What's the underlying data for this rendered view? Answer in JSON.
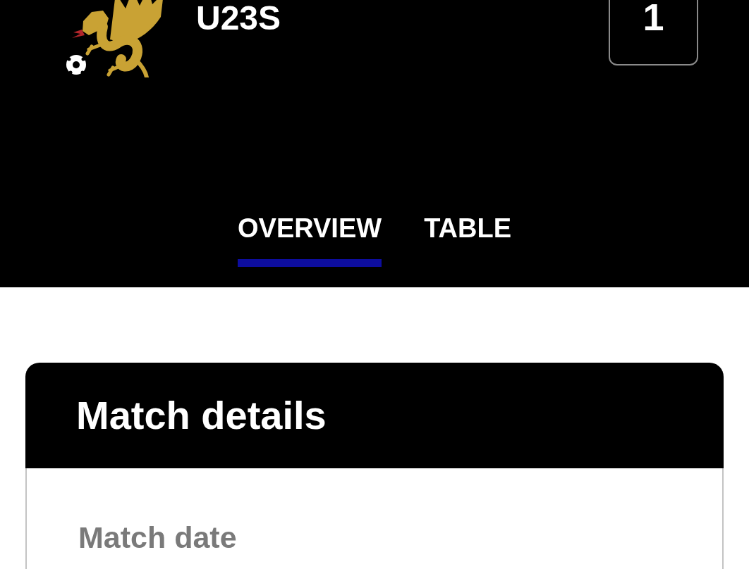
{
  "header": {
    "team": "U23S",
    "score": "1"
  },
  "tabs": [
    {
      "label": "OVERVIEW",
      "selected": true
    },
    {
      "label": "TABLE",
      "selected": false
    }
  ],
  "match_details": {
    "title": "Match details",
    "fields": [
      {
        "label": "Match date"
      }
    ]
  }
}
